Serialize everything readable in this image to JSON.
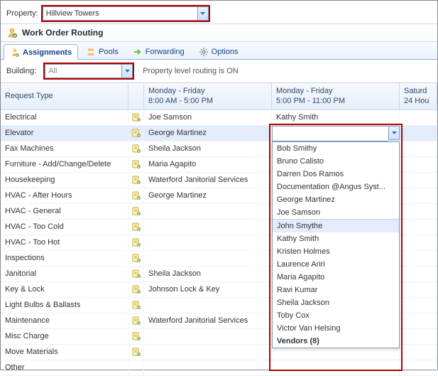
{
  "property": {
    "label": "Property:",
    "value": "Hillview Towers"
  },
  "section_title": "Work Order Routing",
  "tabs": {
    "assignments": "Assignments",
    "pools": "Pools",
    "forwarding": "Forwarding",
    "options": "Options"
  },
  "filter": {
    "building_label": "Building:",
    "building_value": "All",
    "status_text": "Property level routing is ON"
  },
  "columns": {
    "request_type": "Request Type",
    "shift1_line1": "Monday - Friday",
    "shift1_line2": "8:00 AM - 5:00 PM",
    "shift2_line1": "Monday - Friday",
    "shift2_line2": "5:00 PM - 11:00 PM",
    "shift3_line1": "Saturd",
    "shift3_line2": "24 Hou"
  },
  "rows": [
    {
      "type": "Electrical",
      "icon": true,
      "a1": "Joe Samson",
      "a2": "Kathy Smith"
    },
    {
      "type": "Elevator",
      "icon": true,
      "a1": "George Martinez",
      "a2": "",
      "selected": true
    },
    {
      "type": "Fax Machines",
      "icon": true,
      "a1": "Sheila Jackson",
      "a2": ""
    },
    {
      "type": "Furniture - Add/Change/Delete",
      "icon": true,
      "a1": "Maria Agapito",
      "a2": ""
    },
    {
      "type": "Housekeeping",
      "icon": true,
      "a1": "Waterford Janitorial Services",
      "a2": ""
    },
    {
      "type": "HVAC - After Hours",
      "icon": true,
      "a1": "George Martinez",
      "a2": ""
    },
    {
      "type": "HVAC - General",
      "icon": true,
      "a1": "",
      "a2": ""
    },
    {
      "type": "HVAC - Too Cold",
      "icon": true,
      "a1": "",
      "a2": ""
    },
    {
      "type": "HVAC - Too Hot",
      "icon": true,
      "a1": "",
      "a2": ""
    },
    {
      "type": "Inspections",
      "icon": true,
      "a1": "",
      "a2": ""
    },
    {
      "type": "Janitorial",
      "icon": true,
      "a1": "Sheila Jackson",
      "a2": ""
    },
    {
      "type": "Key & Lock",
      "icon": true,
      "a1": "Johnson Lock & Key",
      "a2": ""
    },
    {
      "type": "Light Bulbs & Ballasts",
      "icon": true,
      "a1": "",
      "a2": ""
    },
    {
      "type": "Maintenance",
      "icon": true,
      "a1": "Waterford Janitorial Services",
      "a2": ""
    },
    {
      "type": "Misc Charge",
      "icon": true,
      "a1": "",
      "a2": ""
    },
    {
      "type": "Move Materials",
      "icon": true,
      "a1": "",
      "a2": ""
    },
    {
      "type": "Other",
      "icon": false,
      "a1": "",
      "a2": "",
      "dim": true
    }
  ],
  "dropdown": {
    "items": [
      {
        "text": "Bob Smithy"
      },
      {
        "text": "Bruno Calisto"
      },
      {
        "text": "Darren Dos Ramos"
      },
      {
        "text": "Documentation @Angus Syst..."
      },
      {
        "text": "George Martinez"
      },
      {
        "text": "Joe Samson"
      },
      {
        "text": "John Smythe",
        "hover": true,
        "dotted": true
      },
      {
        "text": "Kathy Smith"
      },
      {
        "text": "Kristen Holmes"
      },
      {
        "text": "Laurence Ariri"
      },
      {
        "text": "Maria Agapito"
      },
      {
        "text": "Ravi Kumar"
      },
      {
        "text": "Sheila Jackson"
      },
      {
        "text": "Toby Cox"
      },
      {
        "text": "Victor Van Helsing"
      },
      {
        "text": "Vendors (8)",
        "bold": true
      }
    ]
  }
}
